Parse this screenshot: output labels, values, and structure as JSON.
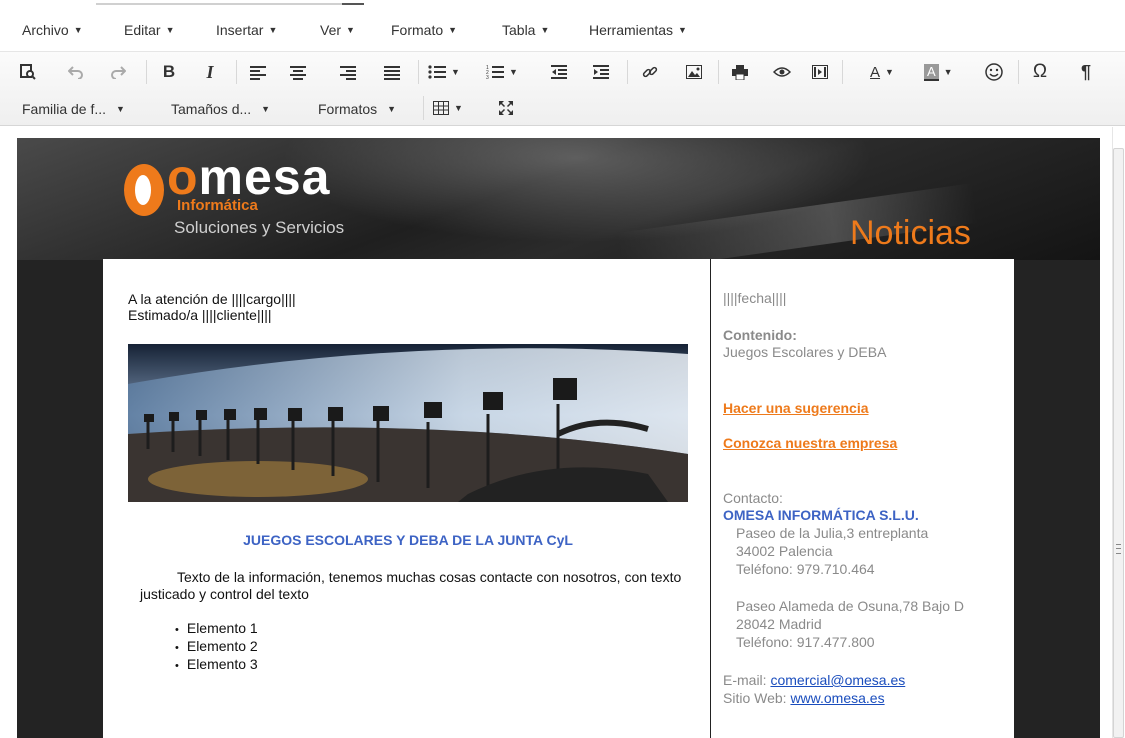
{
  "menubar": {
    "items": [
      {
        "label": "Archivo"
      },
      {
        "label": "Editar"
      },
      {
        "label": "Insertar"
      },
      {
        "label": "Ver"
      },
      {
        "label": "Formato"
      },
      {
        "label": "Tabla"
      },
      {
        "label": "Herramientas"
      }
    ]
  },
  "toolbar": {
    "bold": "B",
    "italic": "I",
    "font_family": "Familia de f...",
    "font_size": "Tamaños d...",
    "formats": "Formatos",
    "text_color": "A",
    "bg_color": "A",
    "omega": "Ω",
    "pilcrow": "¶"
  },
  "email": {
    "logo": {
      "word_prefix": "",
      "word_o": "o",
      "word_rest": "mesa",
      "sub": "Informática",
      "tagline": "Soluciones y Servicios"
    },
    "banner_title": "Noticias",
    "greeting_line1": "A la atención de ||||cargo||||",
    "greeting_line2": "Estimado/a ||||cliente||||",
    "article_title": "JUEGOS ESCOLARES Y DEBA DE LA JUNTA CyL",
    "article_body": "Texto de la información, tenemos muchas cosas contacte con nosotros, con texto justicado y control del texto",
    "list_items": [
      "Elemento 1",
      "Elemento 2",
      "Elemento 3"
    ],
    "sidebar": {
      "date_placeholder": "||||fecha||||",
      "content_label": "Contenido:",
      "content_value": "Juegos Escolares y DEBA",
      "link_suggestion": "Hacer una sugerencia",
      "link_company": "Conozca nuestra empresa",
      "contact_label": "Contacto:",
      "company_name": "OMESA INFORMÁTICA S.L.U.",
      "office1_line1": "Paseo de la Julia,3 entreplanta",
      "office1_line2": "34002 Palencia",
      "office1_phone": "Teléfono: 979.710.464",
      "office2_line1": "Paseo Alameda de Osuna,78 Bajo D",
      "office2_line2": "28042 Madrid",
      "office2_phone": "Teléfono: 917.477.800",
      "email_label": "E-mail: ",
      "email_value": "comercial@omesa.es",
      "web_label": "Sitio Web: ",
      "web_value": "www.omesa.es"
    }
  },
  "colors": {
    "brand_orange": "#ee7a1b",
    "title_blue": "#3d63c4",
    "header_dark": "#232323"
  }
}
